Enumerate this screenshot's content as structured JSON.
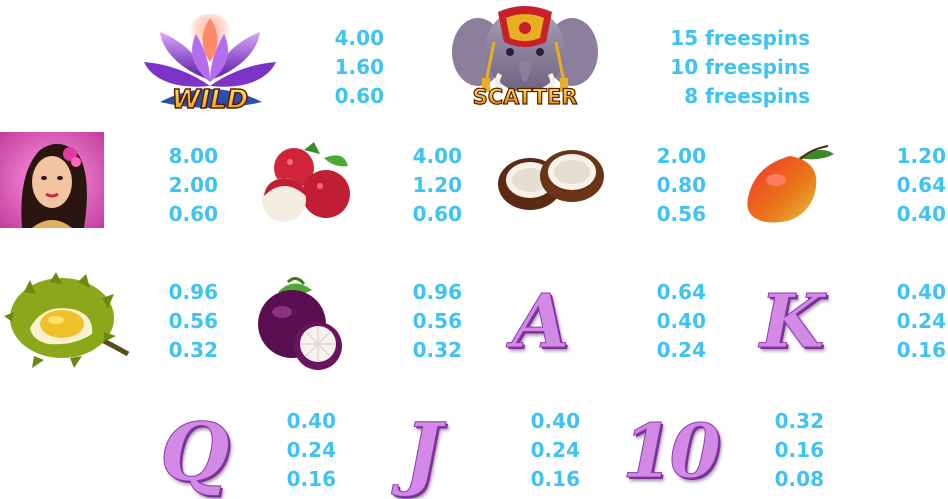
{
  "symbols": {
    "wild": {
      "label": "WILD",
      "pays": [
        "4.00",
        "1.60",
        "0.60"
      ]
    },
    "scatter": {
      "label": "SCATTER",
      "pays": [
        "15 freespins",
        "10 freespins",
        "8 freespins"
      ]
    },
    "woman": {
      "pays": [
        "8.00",
        "2.00",
        "0.60"
      ]
    },
    "lychee": {
      "pays": [
        "4.00",
        "1.20",
        "0.60"
      ]
    },
    "coconut": {
      "pays": [
        "2.00",
        "0.80",
        "0.56"
      ]
    },
    "mango": {
      "pays": [
        "1.20",
        "0.64",
        "0.40"
      ]
    },
    "durian": {
      "pays": [
        "0.96",
        "0.56",
        "0.32"
      ]
    },
    "mangosteen": {
      "pays": [
        "0.96",
        "0.56",
        "0.32"
      ]
    },
    "a": {
      "label": "A",
      "pays": [
        "0.64",
        "0.40",
        "0.24"
      ]
    },
    "k": {
      "label": "K",
      "pays": [
        "0.40",
        "0.24",
        "0.16"
      ]
    },
    "q": {
      "label": "Q",
      "pays": [
        "0.40",
        "0.24",
        "0.16"
      ]
    },
    "j": {
      "label": "J",
      "pays": [
        "0.40",
        "0.24",
        "0.16"
      ]
    },
    "ten": {
      "label": "10",
      "pays": [
        "0.32",
        "0.16",
        "0.08"
      ]
    }
  },
  "colors": {
    "pay_text": "#3ec3f2",
    "letter_fill": "#d28ae6",
    "letter_shadow": "#7a2f94"
  }
}
